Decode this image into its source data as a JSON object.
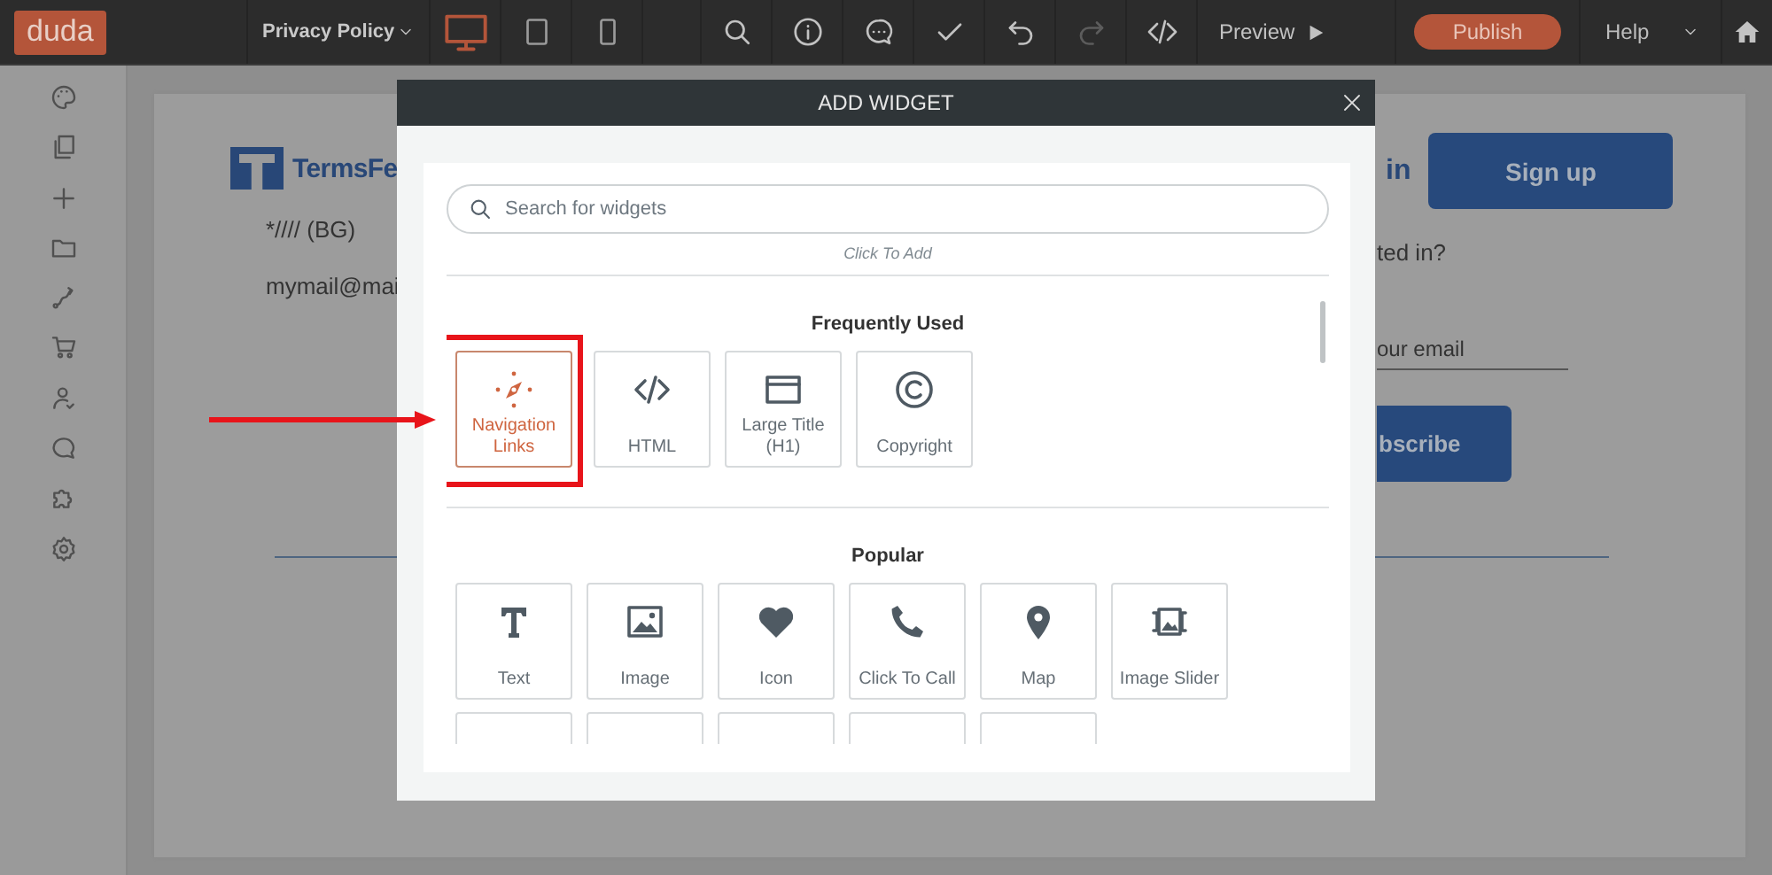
{
  "toolbar": {
    "logo": "duda",
    "page_select": "Privacy Policy",
    "devices": [
      {
        "kind": "desktop",
        "selected": true
      },
      {
        "kind": "tablet",
        "selected": false
      },
      {
        "kind": "mobile",
        "selected": false
      }
    ],
    "tools": [
      {
        "kind": "search",
        "disabled": false
      },
      {
        "kind": "info",
        "disabled": false
      },
      {
        "kind": "comment",
        "disabled": false
      },
      {
        "kind": "check",
        "disabled": false
      },
      {
        "kind": "undo",
        "disabled": false
      },
      {
        "kind": "redo",
        "disabled": true
      },
      {
        "kind": "code",
        "disabled": false
      }
    ],
    "preview": "Preview",
    "publish": "Publish",
    "help": "Help"
  },
  "sidebar": {
    "items": [
      {
        "kind": "palette"
      },
      {
        "kind": "pages"
      },
      {
        "kind": "add"
      },
      {
        "kind": "folder"
      },
      {
        "kind": "flow"
      },
      {
        "kind": "cart"
      },
      {
        "kind": "user"
      },
      {
        "kind": "chat"
      },
      {
        "kind": "puzzle"
      },
      {
        "kind": "settings"
      }
    ]
  },
  "page": {
    "brand": "TermsFe",
    "login": "in",
    "signup": "Sign up",
    "phone": "*//// (BG)",
    "email": "mymail@mai",
    "question": "ted in?",
    "email_placeholder": "our email",
    "subscribe": "bscribe"
  },
  "dialog": {
    "title": "ADD WIDGET",
    "search_placeholder": "Search for widgets",
    "hint": "Click To Add",
    "sections": [
      {
        "title": "Frequently Used",
        "widgets": [
          {
            "kind": "navigation",
            "label": "Navigation Links",
            "selected": true
          },
          {
            "kind": "html",
            "label": "HTML",
            "selected": false
          },
          {
            "kind": "title",
            "label": "Large Title (H1)",
            "selected": false
          },
          {
            "kind": "copyright",
            "label": "Copyright",
            "selected": false
          }
        ]
      },
      {
        "title": "Popular",
        "widgets": [
          {
            "kind": "text",
            "label": "Text",
            "selected": false
          },
          {
            "kind": "image",
            "label": "Image",
            "selected": false
          },
          {
            "kind": "icon",
            "label": "Icon",
            "selected": false
          },
          {
            "kind": "call",
            "label": "Click To Call",
            "selected": false
          },
          {
            "kind": "map",
            "label": "Map",
            "selected": false
          },
          {
            "kind": "slider",
            "label": "Image Slider",
            "selected": false
          },
          {
            "kind": "cut"
          },
          {
            "kind": "cut"
          },
          {
            "kind": "cut"
          },
          {
            "kind": "cut"
          },
          {
            "kind": "cut"
          }
        ]
      }
    ]
  },
  "annotation": {
    "kind": "arrow-and-box"
  }
}
